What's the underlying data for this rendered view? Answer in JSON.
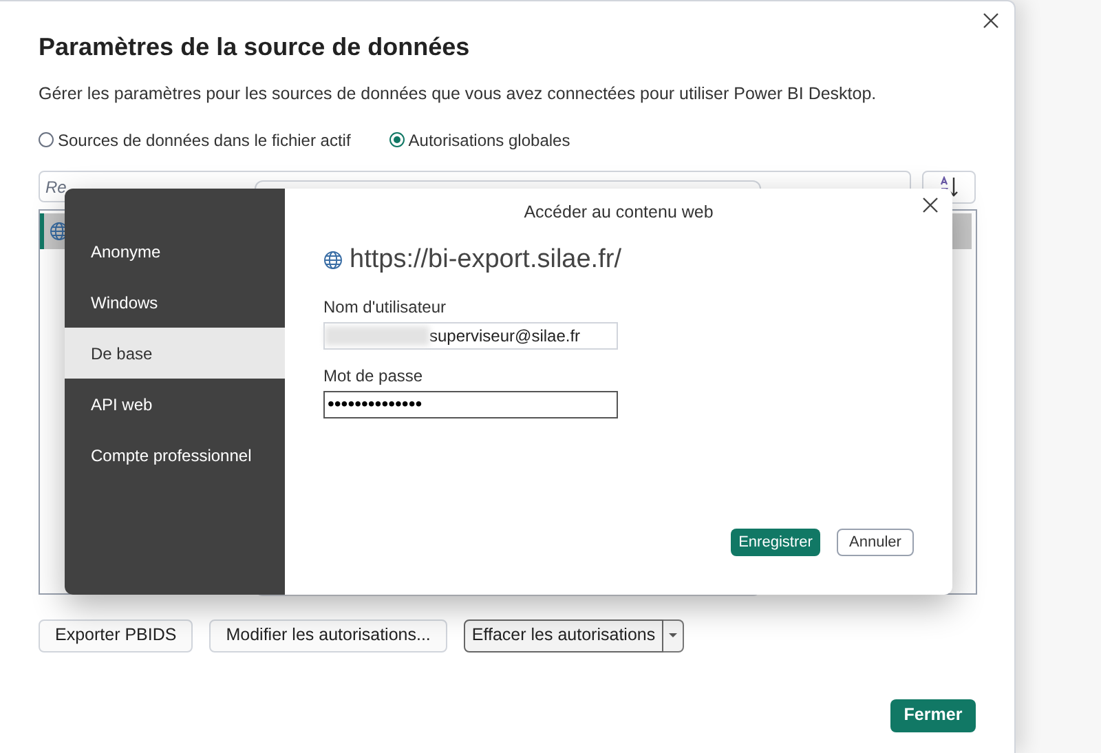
{
  "window": {
    "title": "Paramètres de la source de données",
    "description": "Gérer les paramètres pour les sources de données que vous avez connectées pour utiliser Power BI Desktop."
  },
  "scope_options": [
    {
      "label": "Sources de données dans le fichier actif",
      "selected": false
    },
    {
      "label": "Autorisations globales",
      "selected": true
    }
  ],
  "search": {
    "placeholder": "Re"
  },
  "sources": [
    {
      "selected": true
    }
  ],
  "action_buttons": [
    {
      "label": "Exporter PBIDS",
      "kind": "plain"
    },
    {
      "label": "Modifier les autorisations...",
      "kind": "plain"
    },
    {
      "label": "Effacer les autorisations",
      "kind": "split"
    }
  ],
  "close_button": "Fermer",
  "credentials_dialog": {
    "title": "Accéder au contenu web",
    "url": "https://bi-export.silae.fr/",
    "auth_types": [
      {
        "label": "Anonyme",
        "selected": false
      },
      {
        "label": "Windows",
        "selected": false
      },
      {
        "label": "De base",
        "selected": true
      },
      {
        "label": "API web",
        "selected": false
      },
      {
        "label": "Compte professionnel",
        "selected": false
      }
    ],
    "username_label": "Nom d'utilisateur",
    "username_value": "superviseur@silae.fr",
    "password_label": "Mot de passe",
    "password_value": "••••••••••••••",
    "save_button": "Enregistrer",
    "cancel_button": "Annuler"
  }
}
